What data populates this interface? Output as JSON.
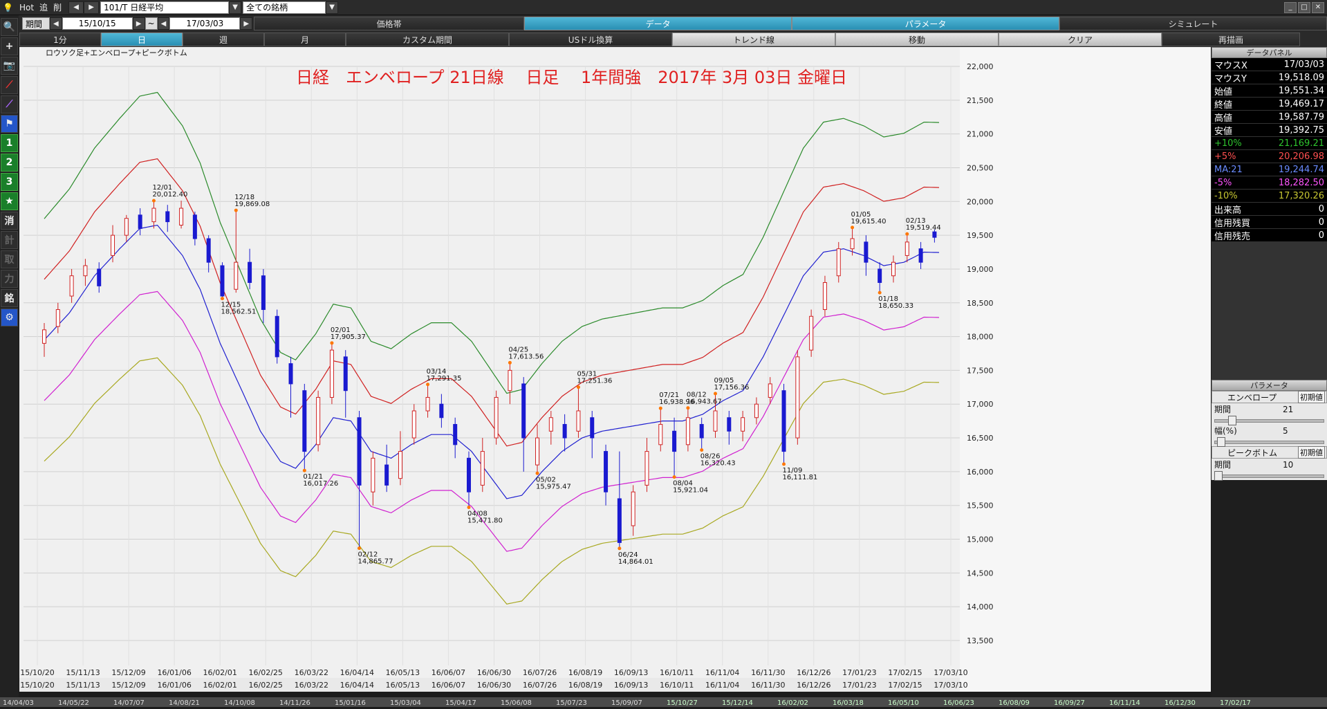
{
  "topbar": {
    "hot": "Hot",
    "tsui": "追",
    "saku": "削",
    "symbol": "101/T 日経平均",
    "universe": "全ての銘柄",
    "tabs": [
      "価格帯",
      "データ",
      "パラメータ",
      "シミュレート"
    ]
  },
  "period": {
    "label": "期間",
    "from": "15/10/15",
    "sep": "~",
    "to": "17/03/03"
  },
  "timeframes": [
    "1分",
    "日",
    "週",
    "月",
    "カスタム期間",
    "USドル換算",
    "トレンド線",
    "移動",
    "クリア",
    "再描画"
  ],
  "leftbar": [
    "1",
    "2",
    "3",
    "★",
    "消",
    "計",
    "取",
    "力",
    "銘"
  ],
  "chart_data": {
    "type": "candlestick",
    "subtitle": "ロウソク足+エンベロープ+ピークボトム",
    "title": "日経　エンベロープ 21日線　 日足　 1年間強　2017年 3月 03日 金曜日",
    "ylim": [
      13500,
      22000
    ],
    "yticks": [
      "13,500",
      "14,000",
      "14,500",
      "15,000",
      "15,500",
      "16,000",
      "16,500",
      "17,000",
      "17,500",
      "18,000",
      "18,500",
      "19,000",
      "19,500",
      "20,000",
      "20,500",
      "21,000",
      "21,500",
      "22,000"
    ],
    "xticks": [
      "15/10/20",
      "15/11/13",
      "15/12/09",
      "16/01/06",
      "16/02/01",
      "16/02/25",
      "16/03/22",
      "16/04/14",
      "16/05/13",
      "16/06/07",
      "16/06/30",
      "16/07/26",
      "16/08/19",
      "16/09/13",
      "16/10/11",
      "16/11/04",
      "16/11/30",
      "16/12/26",
      "17/01/23",
      "17/02/15",
      "17/03/10"
    ],
    "long_axis": [
      "14/04/03",
      "14/05/22",
      "14/07/07",
      "14/08/21",
      "14/10/08",
      "14/11/26",
      "15/01/16",
      "15/03/04",
      "15/04/17",
      "15/06/08",
      "15/07/23",
      "15/09/07",
      "15/10/27",
      "15/12/14",
      "16/02/02",
      "16/03/18",
      "16/05/10",
      "16/06/23",
      "16/08/09",
      "16/09/27",
      "16/11/14",
      "16/12/30",
      "17/02/17"
    ],
    "ma": [
      {
        "i": 0,
        "v": 17950
      },
      {
        "i": 10,
        "v": 18350
      },
      {
        "i": 20,
        "v": 18900
      },
      {
        "i": 30,
        "v": 19300
      },
      {
        "i": 38,
        "v": 19600
      },
      {
        "i": 45,
        "v": 19650
      },
      {
        "i": 55,
        "v": 19200
      },
      {
        "i": 62,
        "v": 18700
      },
      {
        "i": 70,
        "v": 17900
      },
      {
        "i": 78,
        "v": 17250
      },
      {
        "i": 86,
        "v": 16600
      },
      {
        "i": 94,
        "v": 16150
      },
      {
        "i": 100,
        "v": 16050
      },
      {
        "i": 108,
        "v": 16400
      },
      {
        "i": 115,
        "v": 16800
      },
      {
        "i": 122,
        "v": 16750
      },
      {
        "i": 130,
        "v": 16300
      },
      {
        "i": 138,
        "v": 16200
      },
      {
        "i": 146,
        "v": 16400
      },
      {
        "i": 154,
        "v": 16550
      },
      {
        "i": 162,
        "v": 16550
      },
      {
        "i": 170,
        "v": 16300
      },
      {
        "i": 178,
        "v": 15900
      },
      {
        "i": 184,
        "v": 15600
      },
      {
        "i": 190,
        "v": 15650
      },
      {
        "i": 198,
        "v": 16000
      },
      {
        "i": 206,
        "v": 16300
      },
      {
        "i": 214,
        "v": 16500
      },
      {
        "i": 222,
        "v": 16600
      },
      {
        "i": 230,
        "v": 16650
      },
      {
        "i": 238,
        "v": 16700
      },
      {
        "i": 246,
        "v": 16750
      },
      {
        "i": 254,
        "v": 16750
      },
      {
        "i": 262,
        "v": 16850
      },
      {
        "i": 270,
        "v": 17050
      },
      {
        "i": 278,
        "v": 17200
      },
      {
        "i": 286,
        "v": 17700
      },
      {
        "i": 294,
        "v": 18300
      },
      {
        "i": 302,
        "v": 18900
      },
      {
        "i": 310,
        "v": 19250
      },
      {
        "i": 318,
        "v": 19300
      },
      {
        "i": 326,
        "v": 19200
      },
      {
        "i": 334,
        "v": 19050
      },
      {
        "i": 342,
        "v": 19100
      },
      {
        "i": 350,
        "v": 19250
      },
      {
        "i": 356,
        "v": 19245
      }
    ],
    "candles": [
      {
        "i": 0,
        "o": 17900,
        "c": 18100,
        "h": 18200,
        "l": 17700
      },
      {
        "i": 3,
        "o": 18150,
        "c": 18400,
        "h": 18500,
        "l": 18050
      },
      {
        "i": 6,
        "o": 18600,
        "c": 18900,
        "h": 19000,
        "l": 18500
      },
      {
        "i": 9,
        "o": 18900,
        "c": 19050,
        "h": 19150,
        "l": 18750
      },
      {
        "i": 12,
        "o": 19000,
        "c": 18750,
        "h": 19100,
        "l": 18650
      },
      {
        "i": 15,
        "o": 19200,
        "c": 19500,
        "h": 19650,
        "l": 19100
      },
      {
        "i": 18,
        "o": 19500,
        "c": 19750,
        "h": 19800,
        "l": 19400
      },
      {
        "i": 21,
        "o": 19800,
        "c": 19600,
        "h": 19900,
        "l": 19500
      },
      {
        "i": 24,
        "o": 19700,
        "c": 19900,
        "h": 20012,
        "l": 19600
      },
      {
        "i": 27,
        "o": 19850,
        "c": 19700,
        "h": 19950,
        "l": 19550
      },
      {
        "i": 30,
        "o": 19650,
        "c": 19900,
        "h": 20012,
        "l": 19600
      },
      {
        "i": 33,
        "o": 19800,
        "c": 19450,
        "h": 19850,
        "l": 19350
      },
      {
        "i": 36,
        "o": 19450,
        "c": 19100,
        "h": 19500,
        "l": 18950
      },
      {
        "i": 39,
        "o": 19050,
        "c": 18600,
        "h": 19100,
        "l": 18562
      },
      {
        "i": 42,
        "o": 18700,
        "c": 19100,
        "h": 19869,
        "l": 18650
      },
      {
        "i": 45,
        "o": 19100,
        "c": 18800,
        "h": 19300,
        "l": 18700
      },
      {
        "i": 48,
        "o": 18900,
        "c": 18400,
        "h": 19000,
        "l": 18200
      },
      {
        "i": 51,
        "o": 18300,
        "c": 17700,
        "h": 18400,
        "l": 17600
      },
      {
        "i": 54,
        "o": 17600,
        "c": 17300,
        "h": 17700,
        "l": 16800
      },
      {
        "i": 57,
        "o": 17200,
        "c": 16300,
        "h": 17300,
        "l": 16017
      },
      {
        "i": 60,
        "o": 16400,
        "c": 17100,
        "h": 17200,
        "l": 16300
      },
      {
        "i": 63,
        "o": 17100,
        "c": 17800,
        "h": 17905,
        "l": 17000
      },
      {
        "i": 66,
        "o": 17700,
        "c": 17200,
        "h": 17800,
        "l": 16800
      },
      {
        "i": 69,
        "o": 16800,
        "c": 15800,
        "h": 16900,
        "l": 14865
      },
      {
        "i": 72,
        "o": 15700,
        "c": 16200,
        "h": 16300,
        "l": 15500
      },
      {
        "i": 75,
        "o": 16100,
        "c": 15800,
        "h": 16400,
        "l": 15700
      },
      {
        "i": 78,
        "o": 15900,
        "c": 16300,
        "h": 16600,
        "l": 15800
      },
      {
        "i": 81,
        "o": 16500,
        "c": 16900,
        "h": 17000,
        "l": 16400
      },
      {
        "i": 84,
        "o": 16900,
        "c": 17100,
        "h": 17291,
        "l": 16800
      },
      {
        "i": 87,
        "o": 17000,
        "c": 16800,
        "h": 17150,
        "l": 16650
      },
      {
        "i": 90,
        "o": 16700,
        "c": 16400,
        "h": 16800,
        "l": 16200
      },
      {
        "i": 93,
        "o": 16200,
        "c": 15700,
        "h": 16300,
        "l": 15471
      },
      {
        "i": 96,
        "o": 15800,
        "c": 16300,
        "h": 16500,
        "l": 15700
      },
      {
        "i": 99,
        "o": 16500,
        "c": 17100,
        "h": 17200,
        "l": 16400
      },
      {
        "i": 102,
        "o": 17200,
        "c": 17500,
        "h": 17613,
        "l": 17000
      },
      {
        "i": 105,
        "o": 17300,
        "c": 16500,
        "h": 17400,
        "l": 16000
      },
      {
        "i": 108,
        "o": 16100,
        "c": 16500,
        "h": 16700,
        "l": 15975
      },
      {
        "i": 111,
        "o": 16600,
        "c": 16800,
        "h": 16900,
        "l": 16400
      },
      {
        "i": 114,
        "o": 16700,
        "c": 16500,
        "h": 16850,
        "l": 16300
      },
      {
        "i": 117,
        "o": 16600,
        "c": 16900,
        "h": 17251,
        "l": 16500
      },
      {
        "i": 120,
        "o": 16800,
        "c": 16500,
        "h": 16900,
        "l": 16200
      },
      {
        "i": 123,
        "o": 16300,
        "c": 15700,
        "h": 16400,
        "l": 15500
      },
      {
        "i": 126,
        "o": 15600,
        "c": 14950,
        "h": 16300,
        "l": 14864
      },
      {
        "i": 129,
        "o": 15200,
        "c": 15700,
        "h": 15800,
        "l": 15050
      },
      {
        "i": 132,
        "o": 15800,
        "c": 16300,
        "h": 16500,
        "l": 15700
      },
      {
        "i": 135,
        "o": 16400,
        "c": 16700,
        "h": 16938,
        "l": 16300
      },
      {
        "i": 138,
        "o": 16600,
        "c": 16300,
        "h": 16800,
        "l": 15921
      },
      {
        "i": 141,
        "o": 16400,
        "c": 16800,
        "h": 16943,
        "l": 16300
      },
      {
        "i": 144,
        "o": 16700,
        "c": 16500,
        "h": 16800,
        "l": 16320
      },
      {
        "i": 147,
        "o": 16600,
        "c": 16900,
        "h": 17156,
        "l": 16500
      },
      {
        "i": 150,
        "o": 16800,
        "c": 16600,
        "h": 16900,
        "l": 16400
      },
      {
        "i": 153,
        "o": 16600,
        "c": 16800,
        "h": 16900,
        "l": 16450
      },
      {
        "i": 156,
        "o": 16800,
        "c": 17000,
        "h": 17100,
        "l": 16700
      },
      {
        "i": 159,
        "o": 17100,
        "c": 17300,
        "h": 17400,
        "l": 17000
      },
      {
        "i": 162,
        "o": 17200,
        "c": 16300,
        "h": 17300,
        "l": 16111
      },
      {
        "i": 165,
        "o": 16500,
        "c": 17700,
        "h": 17800,
        "l": 16400
      },
      {
        "i": 168,
        "o": 17800,
        "c": 18300,
        "h": 18400,
        "l": 17700
      },
      {
        "i": 171,
        "o": 18400,
        "c": 18800,
        "h": 18900,
        "l": 18300
      },
      {
        "i": 174,
        "o": 18900,
        "c": 19300,
        "h": 19400,
        "l": 18800
      },
      {
        "i": 177,
        "o": 19300,
        "c": 19450,
        "h": 19615,
        "l": 19200
      },
      {
        "i": 180,
        "o": 19400,
        "c": 19100,
        "h": 19500,
        "l": 18900
      },
      {
        "i": 183,
        "o": 19000,
        "c": 18800,
        "h": 19100,
        "l": 18650
      },
      {
        "i": 186,
        "o": 18900,
        "c": 19100,
        "h": 19200,
        "l": 18800
      },
      {
        "i": 189,
        "o": 19200,
        "c": 19400,
        "h": 19519,
        "l": 19100
      },
      {
        "i": 192,
        "o": 19300,
        "c": 19100,
        "h": 19400,
        "l": 19000
      },
      {
        "i": 195,
        "o": 19551,
        "c": 19469,
        "h": 19587,
        "l": 19392
      }
    ],
    "envelopes": [
      {
        "name": "+10%",
        "color": "#2a8a2a",
        "pct": 1.1
      },
      {
        "name": "+5%",
        "color": "#d02020",
        "pct": 1.05
      },
      {
        "name": "MA:21",
        "color": "#2020d0",
        "pct": 1.0
      },
      {
        "name": "-5%",
        "color": "#d020d0",
        "pct": 0.95
      },
      {
        "name": "-10%",
        "color": "#a8a820",
        "pct": 0.9
      }
    ],
    "peaks": [
      {
        "i": 24,
        "label": "12/01",
        "value": "20,012.40"
      },
      {
        "i": 42,
        "label": "12/18",
        "value": "19,869.08"
      },
      {
        "i": 39,
        "label": "12/15",
        "value": "18,562.51"
      },
      {
        "i": 63,
        "label": "02/01",
        "value": "17,905.37"
      },
      {
        "i": 57,
        "label": "01/21",
        "value": "16,017.26"
      },
      {
        "i": 69,
        "label": "02/12",
        "value": "14,865.77"
      },
      {
        "i": 84,
        "label": "03/14",
        "value": "17,291.35"
      },
      {
        "i": 93,
        "label": "04/08",
        "value": "15,471.80"
      },
      {
        "i": 102,
        "label": "04/25",
        "value": "17,613.56"
      },
      {
        "i": 108,
        "label": "05/02",
        "value": "15,975.47"
      },
      {
        "i": 117,
        "label": "05/31",
        "value": "17,251.36"
      },
      {
        "i": 126,
        "label": "06/24",
        "value": "14,864.01"
      },
      {
        "i": 135,
        "label": "07/21",
        "value": "16,938.96"
      },
      {
        "i": 138,
        "label": "08/04",
        "value": "15,921.04"
      },
      {
        "i": 141,
        "label": "08/12",
        "value": "16,943.67"
      },
      {
        "i": 144,
        "label": "08/26",
        "value": "16,320.43"
      },
      {
        "i": 147,
        "label": "09/05",
        "value": "17,156.36"
      },
      {
        "i": 162,
        "label": "11/09",
        "value": "16,111.81"
      },
      {
        "i": 177,
        "label": "01/05",
        "value": "19,615.40"
      },
      {
        "i": 183,
        "label": "01/18",
        "value": "18,650.33"
      },
      {
        "i": 189,
        "label": "02/13",
        "value": "19,519.44"
      }
    ]
  },
  "panel": {
    "header": "データパネル",
    "rows": [
      {
        "k": "マウスX",
        "v": "17/03/03",
        "cls": ""
      },
      {
        "k": "マウスY",
        "v": "19,518.09",
        "cls": ""
      },
      {
        "k": "始値",
        "v": "19,551.34",
        "cls": ""
      },
      {
        "k": "終値",
        "v": "19,469.17",
        "cls": ""
      },
      {
        "k": "高値",
        "v": "19,587.79",
        "cls": ""
      },
      {
        "k": "安値",
        "v": "19,392.75",
        "cls": ""
      },
      {
        "k": "+10%",
        "v": "21,169.21",
        "cls": "g"
      },
      {
        "k": "+5%",
        "v": "20,206.98",
        "cls": "r"
      },
      {
        "k": "MA:21",
        "v": "19,244.74",
        "cls": "b"
      },
      {
        "k": "-5%",
        "v": "18,282.50",
        "cls": "m"
      },
      {
        "k": "-10%",
        "v": "17,320.26",
        "cls": "y"
      },
      {
        "k": "出来高",
        "v": "0",
        "cls": ""
      },
      {
        "k": "信用残買",
        "v": "0",
        "cls": ""
      },
      {
        "k": "信用残売",
        "v": "0",
        "cls": ""
      }
    ],
    "param_header": "パラメータ",
    "env_label": "エンベロープ",
    "init": "初期値",
    "period_label": "期間",
    "period_val": "21",
    "width_label": "幅(%)",
    "width_val": "5",
    "pb_label": "ピークボトム",
    "pb_period_label": "期間",
    "pb_period_val": "10"
  }
}
